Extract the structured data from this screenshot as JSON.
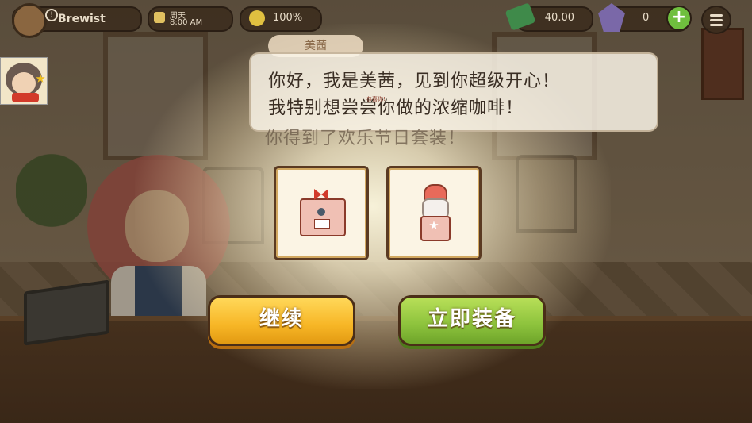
{
  "hud": {
    "player_name": "Brewist",
    "alert_mark": "!",
    "day_label": "周天",
    "time": "8:00 AM",
    "mood_percent": "100%",
    "money": "40.00",
    "gems": "0",
    "plus_label": "+"
  },
  "dialog": {
    "speaker": "美茜",
    "line1": "你好，我是美茜，见到你超级开心！",
    "line2": "我特别想尝尝你做的浓缩咖啡！",
    "tiny_label": "恭喜你!",
    "reward_message": "你得到了欢乐节日套装！"
  },
  "rewards": [
    {
      "icon": "espresso-machine-icon"
    },
    {
      "icon": "coffee-grinder-icon"
    }
  ],
  "buttons": {
    "continue": "继续",
    "equip_now": "立即装备"
  },
  "colors": {
    "continue_button": "#f7b626",
    "equip_button": "#8cc23c",
    "money_icon": "#3f8a4a",
    "gem_icon": "#7a68a8"
  }
}
